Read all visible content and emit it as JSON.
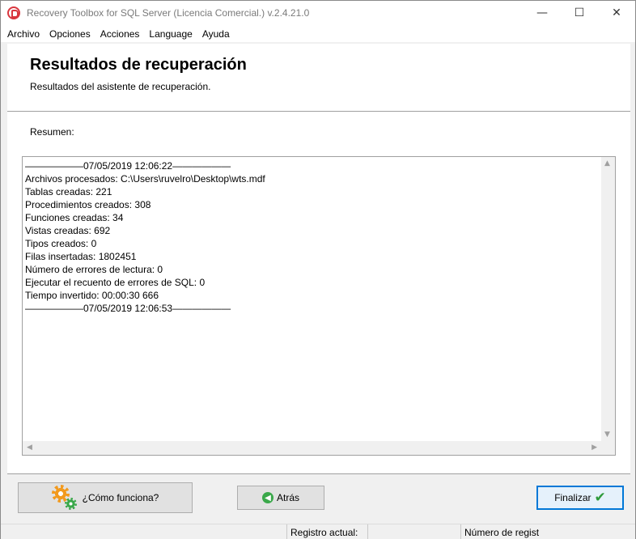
{
  "window": {
    "title": "Recovery Toolbox for SQL Server (Licencia Comercial.) v.2.4.21.0",
    "controls": {
      "minimize": "—",
      "maximize": "☐",
      "close": "✕"
    }
  },
  "menu": {
    "items": [
      {
        "label": "Archivo"
      },
      {
        "label": "Opciones"
      },
      {
        "label": "Acciones"
      },
      {
        "label": "Language"
      },
      {
        "label": "Ayuda"
      }
    ]
  },
  "header": {
    "title": "Resultados de recuperación",
    "subtitle": "Resultados del asistente de recuperación."
  },
  "summary": {
    "label": "Resumen:",
    "lines": [
      "——————07/05/2019 12:06:22——————",
      "Archivos procesados: C:\\Users\\ruvelro\\Desktop\\wts.mdf",
      "Tablas creadas: 221",
      "Procedimientos creados: 308",
      "Funciones creadas: 34",
      "Vistas creadas: 692",
      "Tipos creados: 0",
      "Filas insertadas: 1802451",
      "Número de errores de lectura: 0",
      "Ejecutar el recuento de errores de SQL: 0",
      "Tiempo invertido: 00:00:30 666",
      "——————07/05/2019 12:06:53——————"
    ]
  },
  "buttons": {
    "help": "¿Cómo funciona?",
    "back": "Atrás",
    "finish": "Finalizar"
  },
  "status": {
    "current_record": "Registro actual:",
    "record_number": "Número de regist"
  },
  "colors": {
    "accent": "#0078d7",
    "gear_orange": "#f29a1e",
    "gear_green": "#3aa84a"
  }
}
